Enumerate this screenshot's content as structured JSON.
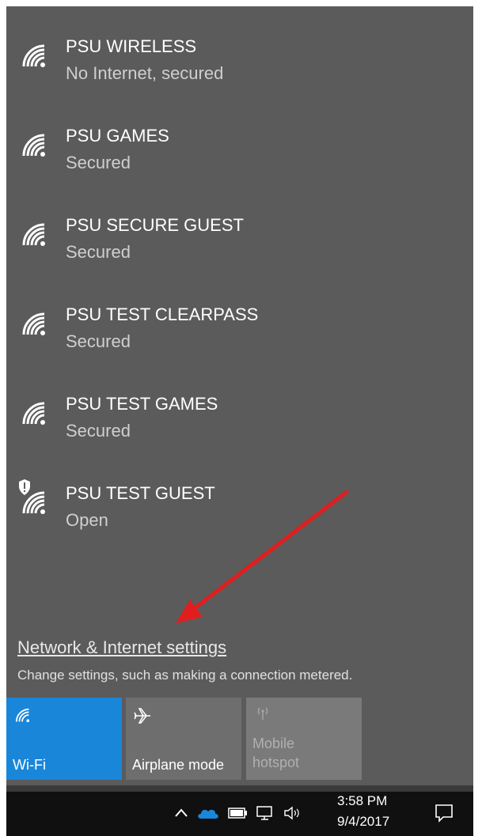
{
  "networks": [
    {
      "name": "PSU WIRELESS",
      "status": "No Internet, secured",
      "icon": "wifi-icon"
    },
    {
      "name": "PSU GAMES",
      "status": "Secured",
      "icon": "wifi-icon"
    },
    {
      "name": "PSU SECURE GUEST",
      "status": "Secured",
      "icon": "wifi-icon"
    },
    {
      "name": "PSU TEST CLEARPASS",
      "status": "Secured",
      "icon": "wifi-icon"
    },
    {
      "name": "PSU TEST GAMES",
      "status": "Secured",
      "icon": "wifi-icon"
    },
    {
      "name": "PSU TEST GUEST",
      "status": "Open",
      "icon": "wifi-open-shield-icon"
    }
  ],
  "settings": {
    "link": "Network & Internet settings",
    "subtitle": "Change settings, such as making a connection metered."
  },
  "quick_actions": [
    {
      "label": "Wi-Fi",
      "state": "on",
      "color": "#1a86d9"
    },
    {
      "label": "Airplane mode",
      "state": "off",
      "color": "#6e6e6e"
    },
    {
      "label_line1": "Mobile",
      "label_line2": "hotspot",
      "state": "disabled",
      "color": "#7a7a7a"
    }
  ],
  "taskbar": {
    "time": "3:58 PM",
    "date": "9/4/2017",
    "icons": [
      "chevron-up-icon",
      "onedrive-icon",
      "battery-icon",
      "network-icon",
      "volume-icon",
      "action-center-icon"
    ]
  },
  "annotation": {
    "arrow_color": "#e01e1e"
  }
}
